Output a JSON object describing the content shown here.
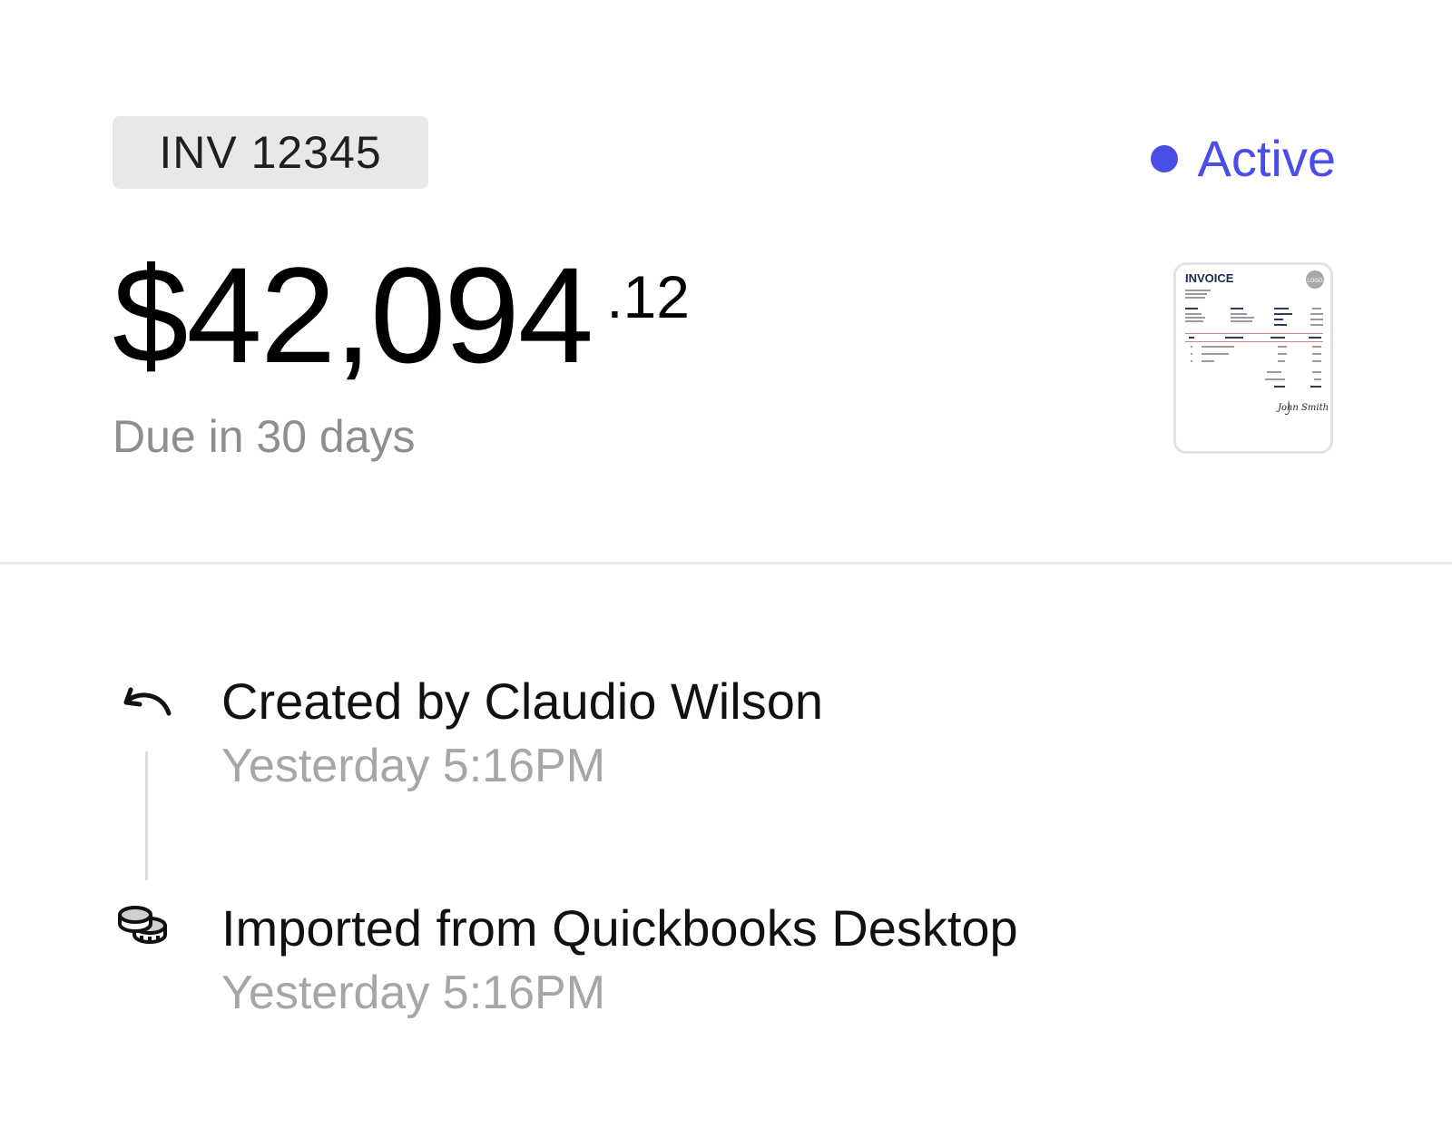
{
  "invoice": {
    "id": "INV 12345",
    "status": "Active",
    "status_color": "#4a4de6",
    "amount_main": "$42,094",
    "amount_cents": ".12",
    "due_text": "Due in 30 days"
  },
  "thumbnail": {
    "heading": "INVOICE",
    "logo_text": "LOGO",
    "signature": "John Smith"
  },
  "timeline": [
    {
      "icon": "undo-arrow-icon",
      "title": "Created by Claudio Wilson",
      "time": "Yesterday 5:16PM"
    },
    {
      "icon": "coins-icon",
      "title": "Imported from Quickbooks Desktop",
      "time": "Yesterday 5:16PM"
    }
  ]
}
